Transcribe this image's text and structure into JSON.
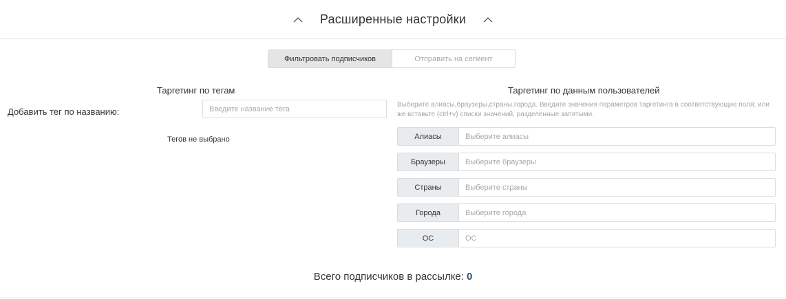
{
  "header": {
    "title": "Расширенные настройки",
    "left_icon": "chevron-up-icon",
    "right_icon": "chevron-up-icon"
  },
  "mode_toggle": {
    "active": "Фильтровать подписчиков",
    "inactive": "Отправить на сегмент"
  },
  "tags": {
    "title": "Таргетинг по тегам",
    "add_label": "Добавить тег по названию:",
    "input_placeholder": "Введите название тега",
    "empty_text": "Тегов не выбрано"
  },
  "users": {
    "title": "Таргетинг по данным пользователей",
    "hint": "Выберите алиасы,браузеры,страны,города. Введите значения параметров таргетинга в соответствующие поля; или же вставьте (ctrl+v) списки значений, разделенные запятыми.",
    "fields": [
      {
        "label": "Алиасы",
        "placeholder": "Выберите алиасы"
      },
      {
        "label": "Браузеры",
        "placeholder": "Выберите браузеры"
      },
      {
        "label": "Страны",
        "placeholder": "Выберите страны"
      },
      {
        "label": "Города",
        "placeholder": "Выберите города"
      },
      {
        "label": "ОС",
        "placeholder": "ОС"
      }
    ]
  },
  "summary": {
    "label": "Всего подписчиков в рассылке:",
    "count": "0"
  },
  "colors": {
    "accent_count": "#2e4f7a",
    "active_tab_bg": "#e5e5e5",
    "field_label_bg": "#e9ecef"
  }
}
